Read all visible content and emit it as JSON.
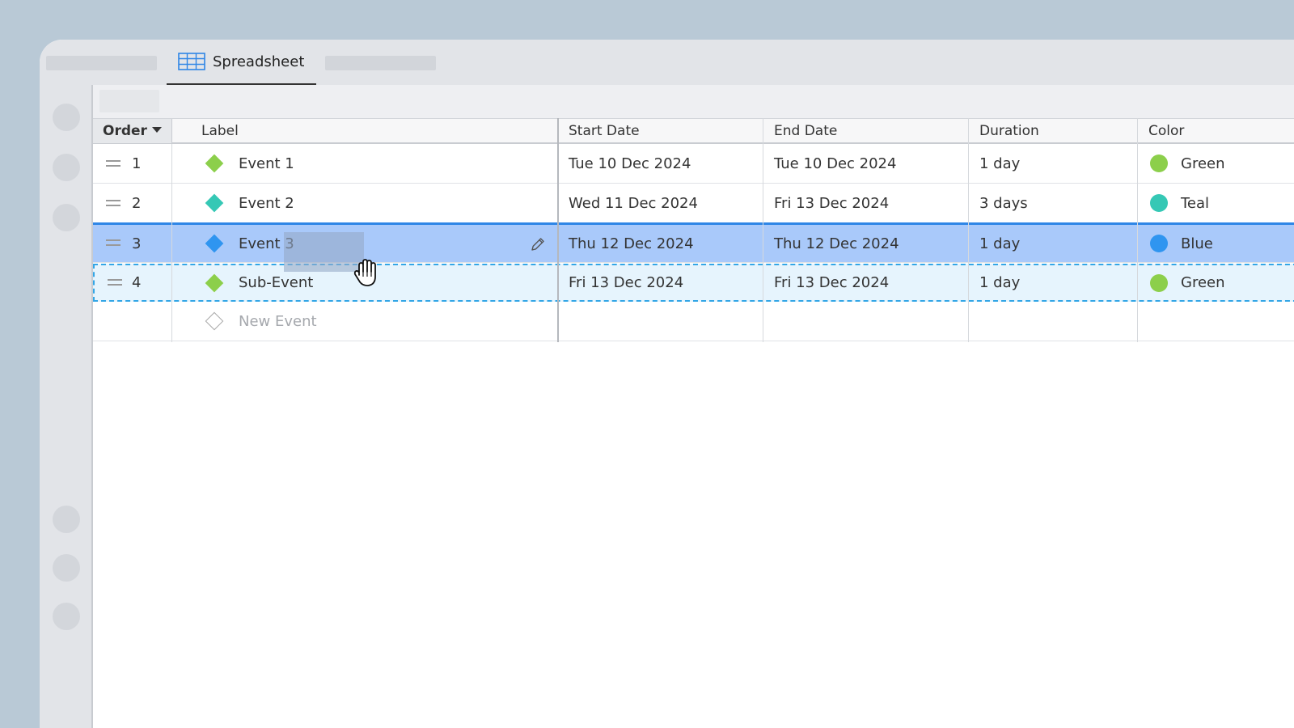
{
  "tab": {
    "label": "Spreadsheet"
  },
  "columns": {
    "order": "Order",
    "label": "Label",
    "start": "Start Date",
    "end": "End Date",
    "duration": "Duration",
    "color": "Color"
  },
  "rows": [
    {
      "order": "1",
      "label": "Event 1",
      "start": "Tue 10 Dec 2024",
      "end": "Tue 10 Dec 2024",
      "duration": "1 day",
      "color": "Green",
      "hex": "#8ccf4b"
    },
    {
      "order": "2",
      "label": "Event 2",
      "start": "Wed 11 Dec 2024",
      "end": "Fri 13 Dec 2024",
      "duration": "3 days",
      "color": "Teal",
      "hex": "#35c8b5"
    },
    {
      "order": "3",
      "label": "Event 3",
      "start": "Thu 12 Dec 2024",
      "end": "Thu 12 Dec 2024",
      "duration": "1 day",
      "color": "Blue",
      "hex": "#2f95f0"
    },
    {
      "order": "4",
      "label": "Sub-Event",
      "start": "Fri 13 Dec 2024",
      "end": "Fri 13 Dec 2024",
      "duration": "1 day",
      "color": "Green",
      "hex": "#8ccf4b"
    }
  ],
  "new_row": {
    "placeholder": "New Event"
  },
  "icons": {
    "tab": "spreadsheet-grid-icon",
    "edit": "pencil-icon",
    "handle": "drag-handle-icon",
    "cursor": "grab-hand-cursor"
  },
  "colors": {
    "selected_row": "#a9c9fa",
    "selection_border": "#2f86e6",
    "drop_target_border": "#33a6e6"
  }
}
